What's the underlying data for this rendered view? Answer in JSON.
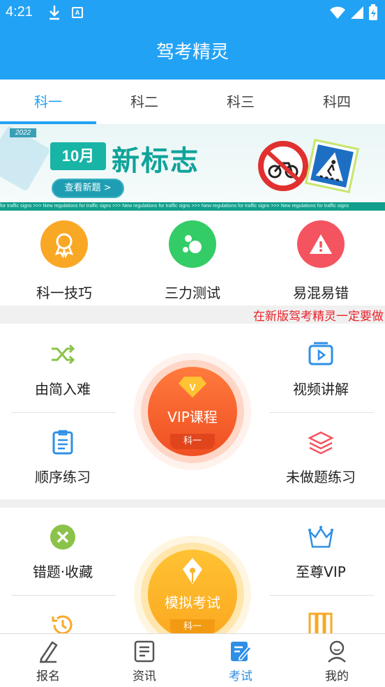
{
  "status_bar": {
    "time": "4:21",
    "icons": [
      "download-icon",
      "accessibility-icon",
      "wifi-icon",
      "signal-icon",
      "battery-icon"
    ]
  },
  "app": {
    "title": "驾考精灵"
  },
  "tabs": [
    {
      "label": "科一",
      "active": true
    },
    {
      "label": "科二",
      "active": false
    },
    {
      "label": "科三",
      "active": false
    },
    {
      "label": "科四",
      "active": false
    }
  ],
  "banner": {
    "year": "2022",
    "month": "10月",
    "headline": "新标志",
    "button": "查看新题 >",
    "strip": "for traffic signs  >>>  New regulations for traffic signs  >>>  New regulations for traffic signs  >>>  New regulations for traffic signs  >>>  New regulations for traffic signs"
  },
  "quick": [
    {
      "label": "科一技巧",
      "icon": "medal-icon",
      "color": "#f9a826"
    },
    {
      "label": "三力测试",
      "icon": "bubbles-icon",
      "color": "#33cc66"
    },
    {
      "label": "易混易错",
      "icon": "warning-icon",
      "color": "#f4545f"
    }
  ],
  "notice": "在新版驾考精灵一定要做",
  "practice": {
    "shuffle": "由简入难",
    "video": "视频讲解",
    "sequence": "顺序练习",
    "undone": "未做题练习",
    "vip_course": {
      "title": "VIP课程",
      "sub": "科一"
    }
  },
  "practice2": {
    "wrong": "错题·收藏",
    "vip": "至尊VIP",
    "mock_exam": {
      "title": "模拟考试",
      "sub": "科一"
    }
  },
  "bottom_nav": [
    {
      "label": "报名",
      "icon": "pen-icon",
      "active": false
    },
    {
      "label": "资讯",
      "icon": "news-icon",
      "active": false
    },
    {
      "label": "考试",
      "icon": "exam-icon",
      "active": true
    },
    {
      "label": "我的",
      "icon": "profile-icon",
      "active": false
    }
  ],
  "colors": {
    "primary": "#22a2f5",
    "vip_orange": "#f4622e",
    "exam_yellow": "#fbb52b",
    "notice_red": "#e8232b"
  }
}
